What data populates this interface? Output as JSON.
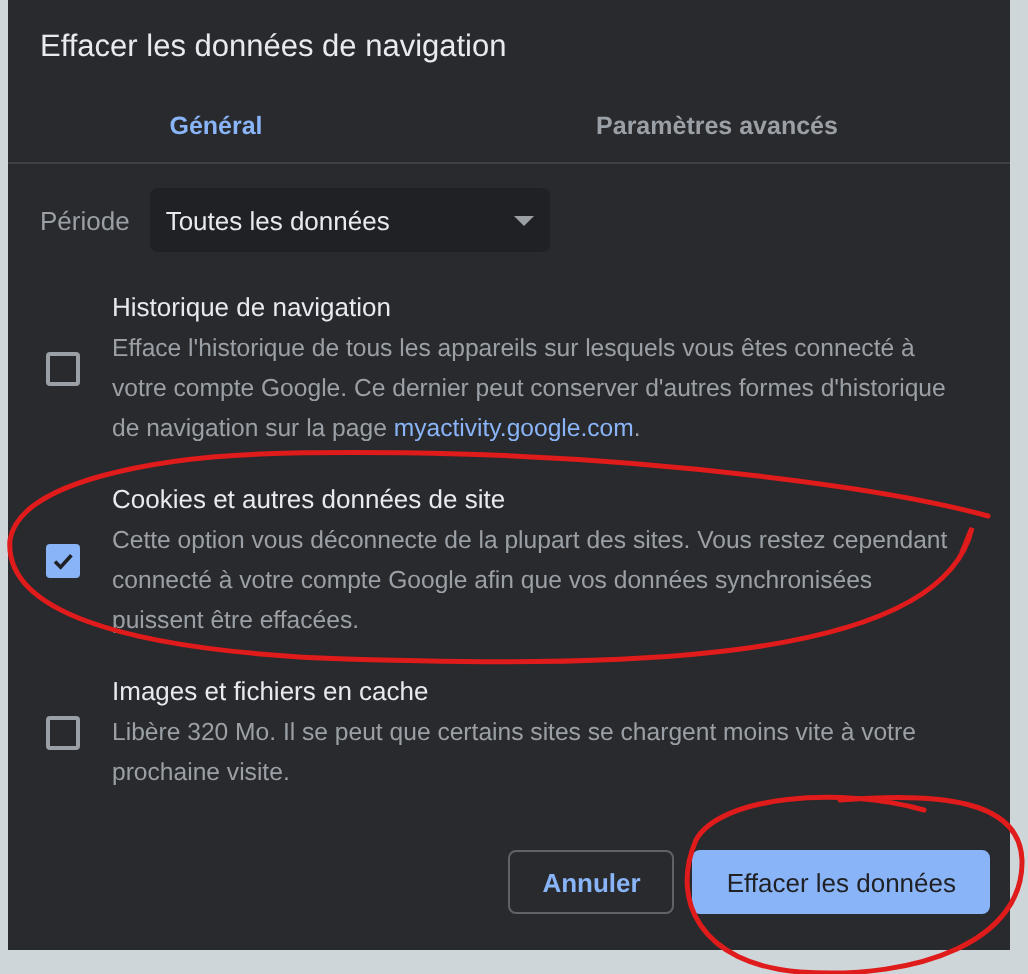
{
  "dialog": {
    "title": "Effacer les données de navigation"
  },
  "tabs": [
    {
      "label": "Général",
      "selected": true
    },
    {
      "label": "Paramètres avancés",
      "selected": false
    }
  ],
  "period": {
    "label": "Période",
    "value": "Toutes les données"
  },
  "options": [
    {
      "title": "Historique de navigation",
      "description": "Efface l'historique de tous les appareils sur lesquels vous êtes connecté à votre compte Google. Ce dernier peut conserver d'autres formes d'historique de navigation sur la page",
      "link": "myactivity.google.com",
      "suffix": ".",
      "checked": false
    },
    {
      "title": "Cookies et autres données de site",
      "description": "Cette option vous déconnecte de la plupart des sites. Vous restez cependant connecté à votre compte Google afin que vos données synchronisées puissent être effacées.",
      "checked": true
    },
    {
      "title": "Images et fichiers en cache",
      "description": "Libère 320 Mo. Il se peut que certains sites se chargent moins vite à votre prochaine visite.",
      "checked": false
    }
  ],
  "buttons": [
    {
      "label": "Annuler",
      "kind": "secondary"
    },
    {
      "label": "Effacer les données",
      "kind": "primary"
    }
  ]
}
